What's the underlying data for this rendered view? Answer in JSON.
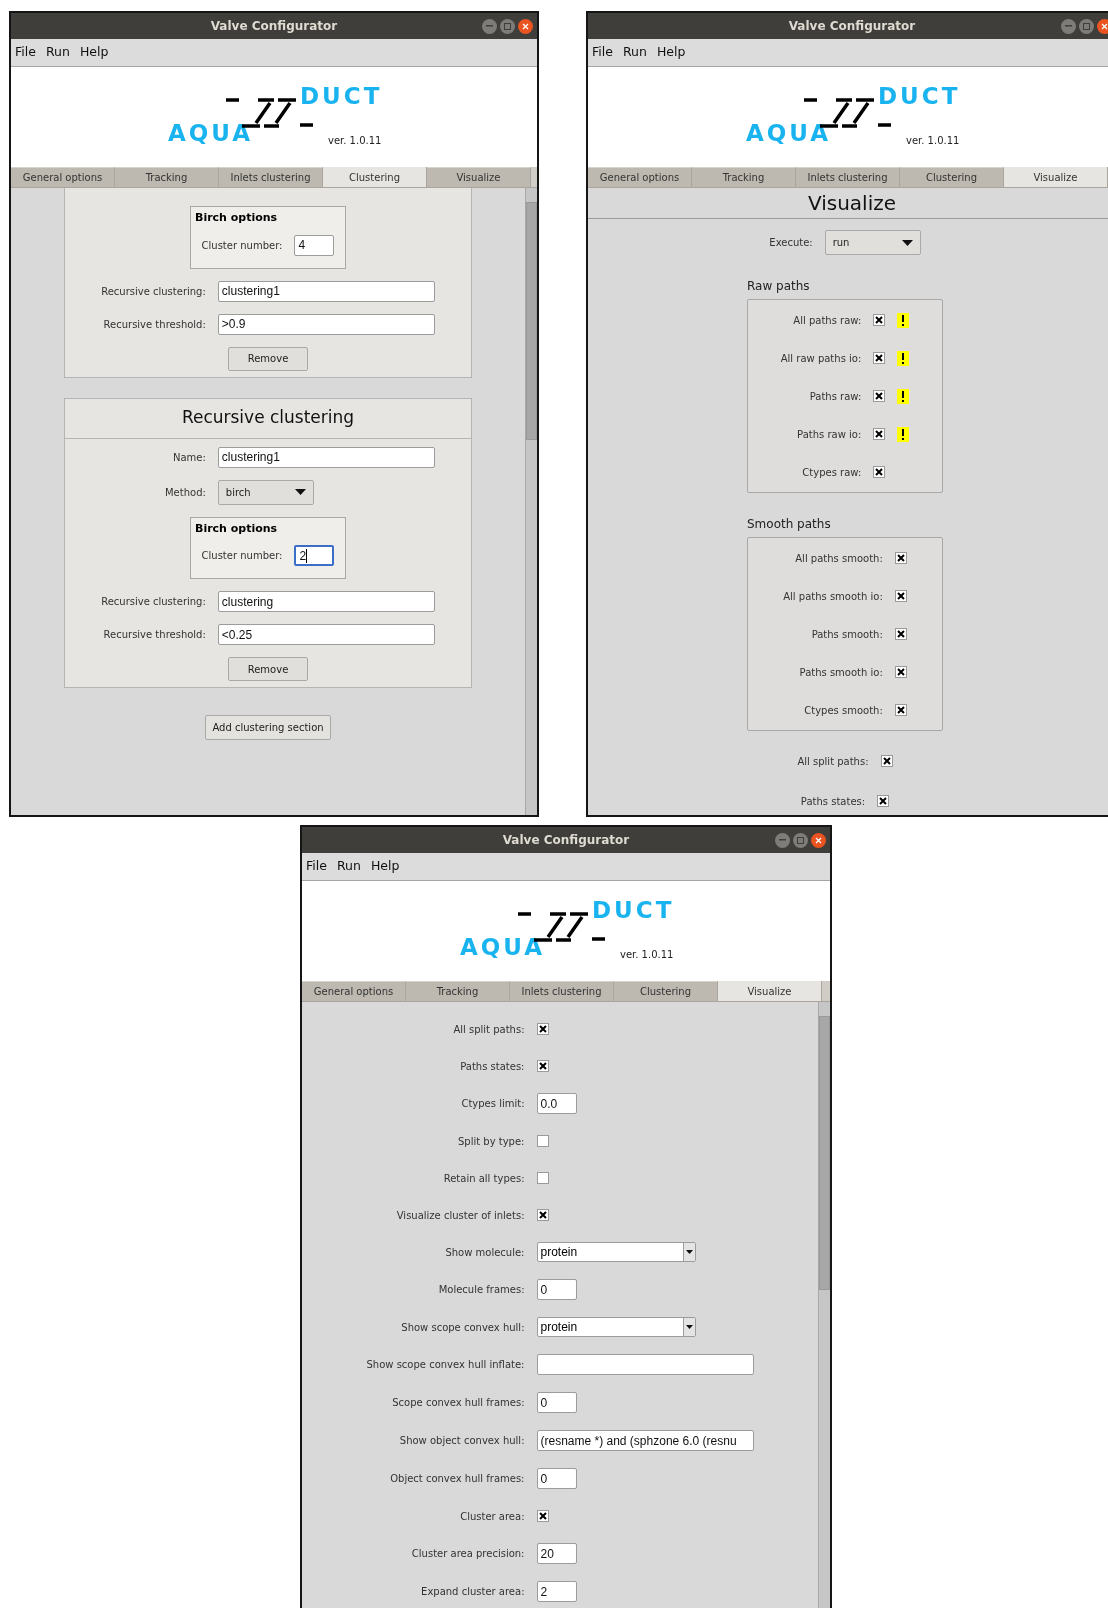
{
  "windows": [
    {
      "title": "Valve Configurator",
      "menu": [
        "File",
        "Run",
        "Help"
      ],
      "logo": {
        "left": "AQUA",
        "right": "DUCT",
        "version": "ver. 1.0.11"
      },
      "tabs": [
        {
          "label": "General options",
          "selected": false
        },
        {
          "label": "Tracking",
          "selected": false
        },
        {
          "label": "Inlets clustering",
          "selected": false
        },
        {
          "label": "Clustering",
          "selected": true
        },
        {
          "label": "Visualize",
          "selected": false
        }
      ],
      "content": {
        "kind": "sections",
        "sections": [
          {
            "rows": [
              {
                "kind": "frame",
                "title": "Birch options",
                "rows": [
                  {
                    "kind": "short_text",
                    "label": "Cluster number:",
                    "value": "4",
                    "focused": false
                  }
                ]
              },
              {
                "kind": "text",
                "label": "Recursive clustering:",
                "value": "clustering1"
              },
              {
                "kind": "text",
                "label": "Recursive threshold:",
                "value": ">0.9"
              },
              {
                "kind": "button",
                "label": "Remove"
              }
            ]
          },
          {
            "title": "Recursive clustering",
            "rows": [
              {
                "kind": "text",
                "label": "Name:",
                "value": "clustering1"
              },
              {
                "kind": "dropdown",
                "label": "Method:",
                "value": "birch"
              },
              {
                "kind": "frame",
                "title": "Birch options",
                "rows": [
                  {
                    "kind": "short_text",
                    "label": "Cluster number:",
                    "value": "2",
                    "focused": true
                  }
                ]
              },
              {
                "kind": "text",
                "label": "Recursive clustering:",
                "value": "clustering"
              },
              {
                "kind": "text",
                "label": "Recursive threshold:",
                "value": "<0.25"
              },
              {
                "kind": "button",
                "label": "Remove"
              }
            ]
          }
        ],
        "footer_button": "Add clustering section"
      }
    },
    {
      "title": "Valve Configurator",
      "menu": [
        "File",
        "Run",
        "Help"
      ],
      "logo": {
        "left": "AQUA",
        "right": "DUCT",
        "version": "ver. 1.0.11"
      },
      "tabs": [
        {
          "label": "General options",
          "selected": false
        },
        {
          "label": "Tracking",
          "selected": false
        },
        {
          "label": "Inlets clustering",
          "selected": false
        },
        {
          "label": "Clustering",
          "selected": false
        },
        {
          "label": "Visualize",
          "selected": true
        }
      ],
      "content": {
        "kind": "stack",
        "heading": "Visualize",
        "rows": [
          {
            "kind": "dropdown",
            "label": "Execute:",
            "value": "run"
          },
          {
            "kind": "panel",
            "title": "Raw paths",
            "rows": [
              {
                "kind": "check",
                "label": "All paths raw:",
                "checked": true,
                "warning": true
              },
              {
                "kind": "check",
                "label": "All raw paths io:",
                "checked": true,
                "warning": true
              },
              {
                "kind": "check",
                "label": "Paths raw:",
                "checked": true,
                "warning": true
              },
              {
                "kind": "check",
                "label": "Paths raw io:",
                "checked": true,
                "warning": true
              },
              {
                "kind": "check",
                "label": "Ctypes raw:",
                "checked": true,
                "warning": false
              }
            ]
          },
          {
            "kind": "panel",
            "title": "Smooth paths",
            "rows": [
              {
                "kind": "check",
                "label": "All paths smooth:",
                "checked": true,
                "warning": false
              },
              {
                "kind": "check",
                "label": "All paths smooth io:",
                "checked": true,
                "warning": false
              },
              {
                "kind": "check",
                "label": "Paths smooth:",
                "checked": true,
                "warning": false
              },
              {
                "kind": "check",
                "label": "Paths smooth io:",
                "checked": true,
                "warning": false
              },
              {
                "kind": "check",
                "label": "Ctypes smooth:",
                "checked": true,
                "warning": false
              }
            ]
          },
          {
            "kind": "check",
            "label": "All split paths:",
            "checked": true,
            "warning": false
          },
          {
            "kind": "check",
            "label": "Paths states:",
            "checked": true,
            "warning": false
          }
        ]
      }
    },
    {
      "title": "Valve Configurator",
      "menu": [
        "File",
        "Run",
        "Help"
      ],
      "logo": {
        "left": "AQUA",
        "right": "DUCT",
        "version": "ver. 1.0.11"
      },
      "tabs": [
        {
          "label": "General options",
          "selected": false
        },
        {
          "label": "Tracking",
          "selected": false
        },
        {
          "label": "Inlets clustering",
          "selected": false
        },
        {
          "label": "Clustering",
          "selected": false
        },
        {
          "label": "Visualize",
          "selected": true
        }
      ],
      "content": {
        "kind": "form",
        "rows": [
          {
            "kind": "check",
            "label": "All split paths:",
            "checked": true,
            "warning": false
          },
          {
            "kind": "check",
            "label": "Paths states:",
            "checked": true,
            "warning": false
          },
          {
            "kind": "short_text",
            "label": "Ctypes limit:",
            "value": "0.0"
          },
          {
            "kind": "check",
            "label": "Split by type:",
            "checked": false,
            "warning": false
          },
          {
            "kind": "check",
            "label": "Retain all types:",
            "checked": false,
            "warning": false
          },
          {
            "kind": "check",
            "label": "Visualize cluster of inlets:",
            "checked": true,
            "warning": false
          },
          {
            "kind": "combo",
            "label": "Show molecule:",
            "value": "protein"
          },
          {
            "kind": "short_text",
            "label": "Molecule frames:",
            "value": "0"
          },
          {
            "kind": "combo",
            "label": "Show scope convex hull:",
            "value": "protein"
          },
          {
            "kind": "text",
            "label": "Show scope convex hull inflate:"
          },
          {
            "kind": "short_text",
            "label": "Scope convex hull frames:",
            "value": "0"
          },
          {
            "kind": "text",
            "label": "Show object convex hull:",
            "value": "(resname *) and (sphzone 6.0 (resnu"
          },
          {
            "kind": "short_text",
            "label": "Object convex hull frames:",
            "value": "0"
          },
          {
            "kind": "check",
            "label": "Cluster area:",
            "checked": true,
            "warning": false
          },
          {
            "kind": "short_text",
            "label": "Cluster area precision:",
            "value": "20"
          },
          {
            "kind": "short_text",
            "label": "Expand cluster area:",
            "value": "2"
          }
        ]
      }
    }
  ]
}
